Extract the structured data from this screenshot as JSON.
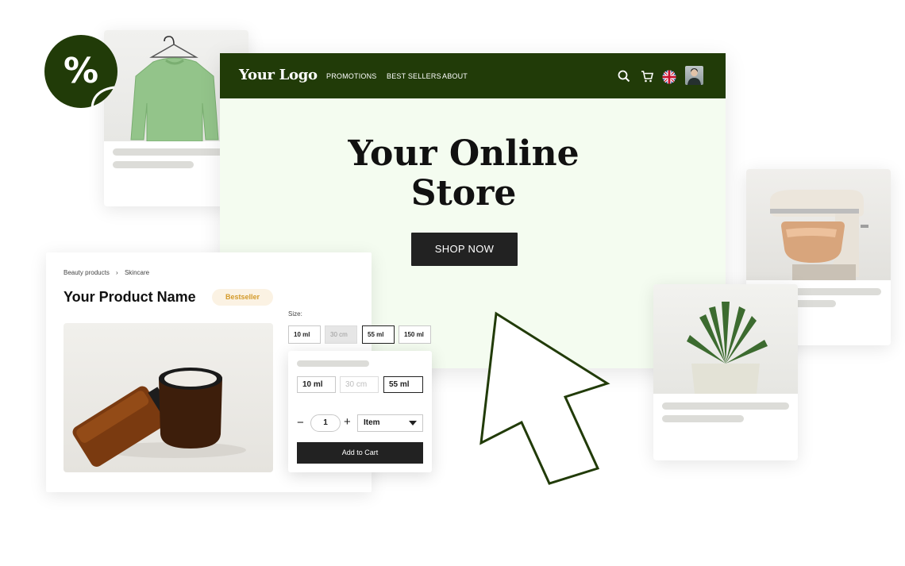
{
  "discount_badge": {
    "symbol": "%"
  },
  "header": {
    "logo": "Your Logo",
    "nav": [
      "PROMOTIONS",
      "BEST SELLERS",
      "ABOUT"
    ],
    "icons": [
      "search-icon",
      "cart-icon",
      "uk-flag-icon",
      "avatar"
    ]
  },
  "hero": {
    "title_line1": "Your Online",
    "title_line2": "Store",
    "cta": "SHOP NOW"
  },
  "product": {
    "breadcrumb": [
      "Beauty products",
      "›",
      "Skincare"
    ],
    "name": "Your Product Name",
    "badge": "Bestseller",
    "size_label": "Size:",
    "sizes": [
      "10 ml",
      "30 cm",
      "55 ml",
      "150 ml"
    ],
    "selected_size": "55 ml",
    "disabled_size": "30 cm"
  },
  "cart_popup": {
    "sizes": [
      "10 ml",
      "30 cm",
      "55 ml"
    ],
    "quantity": "1",
    "minus": "−",
    "plus": "+",
    "item_select": "Item",
    "add_to_cart": "Add to Cart"
  },
  "colors": {
    "brand_green": "#213b08",
    "hero_bg": "#f4fcf0",
    "button_dark": "#222222",
    "badge_text": "#d39a2a",
    "badge_bg": "#fbf2e3"
  }
}
